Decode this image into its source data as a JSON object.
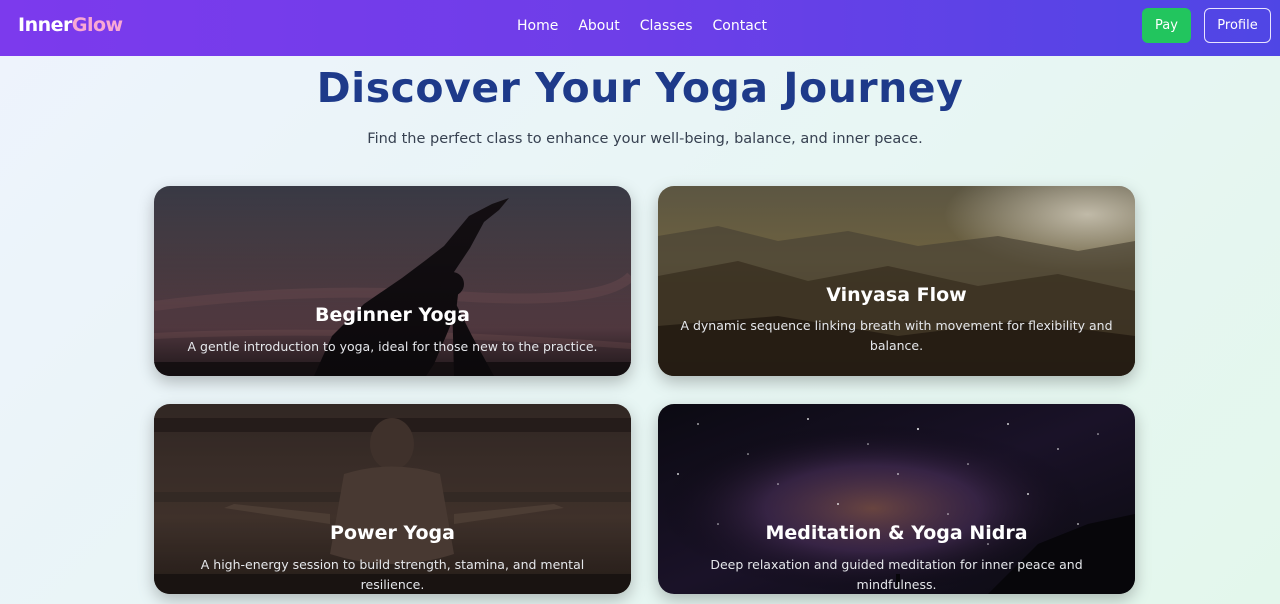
{
  "brand": {
    "part1": "Inner",
    "part2": "Glow"
  },
  "nav": {
    "links": [
      "Home",
      "About",
      "Classes",
      "Contact"
    ],
    "pay_label": "Pay",
    "profile_label": "Profile"
  },
  "hero": {
    "title": "Discover Your Yoga Journey",
    "subtitle": "Find the perfect class to enhance your well-being, balance, and inner peace."
  },
  "classes": [
    {
      "title": "Beginner Yoga",
      "description": "A gentle introduction to yoga, ideal for those new to the practice."
    },
    {
      "title": "Vinyasa Flow",
      "description": "A dynamic sequence linking breath with movement for flexibility and balance."
    },
    {
      "title": "Power Yoga",
      "description": "A high-energy session to build strength, stamina, and mental resilience."
    },
    {
      "title": "Meditation & Yoga Nidra",
      "description": "Deep relaxation and guided meditation for inner peace and mindfulness."
    }
  ],
  "colors": {
    "navbar_start": "#7c3aed",
    "navbar_end": "#4f46e5",
    "pay_button": "#22c55e",
    "title": "#1e3a8a",
    "brand_accent": "#f9a8d4"
  }
}
